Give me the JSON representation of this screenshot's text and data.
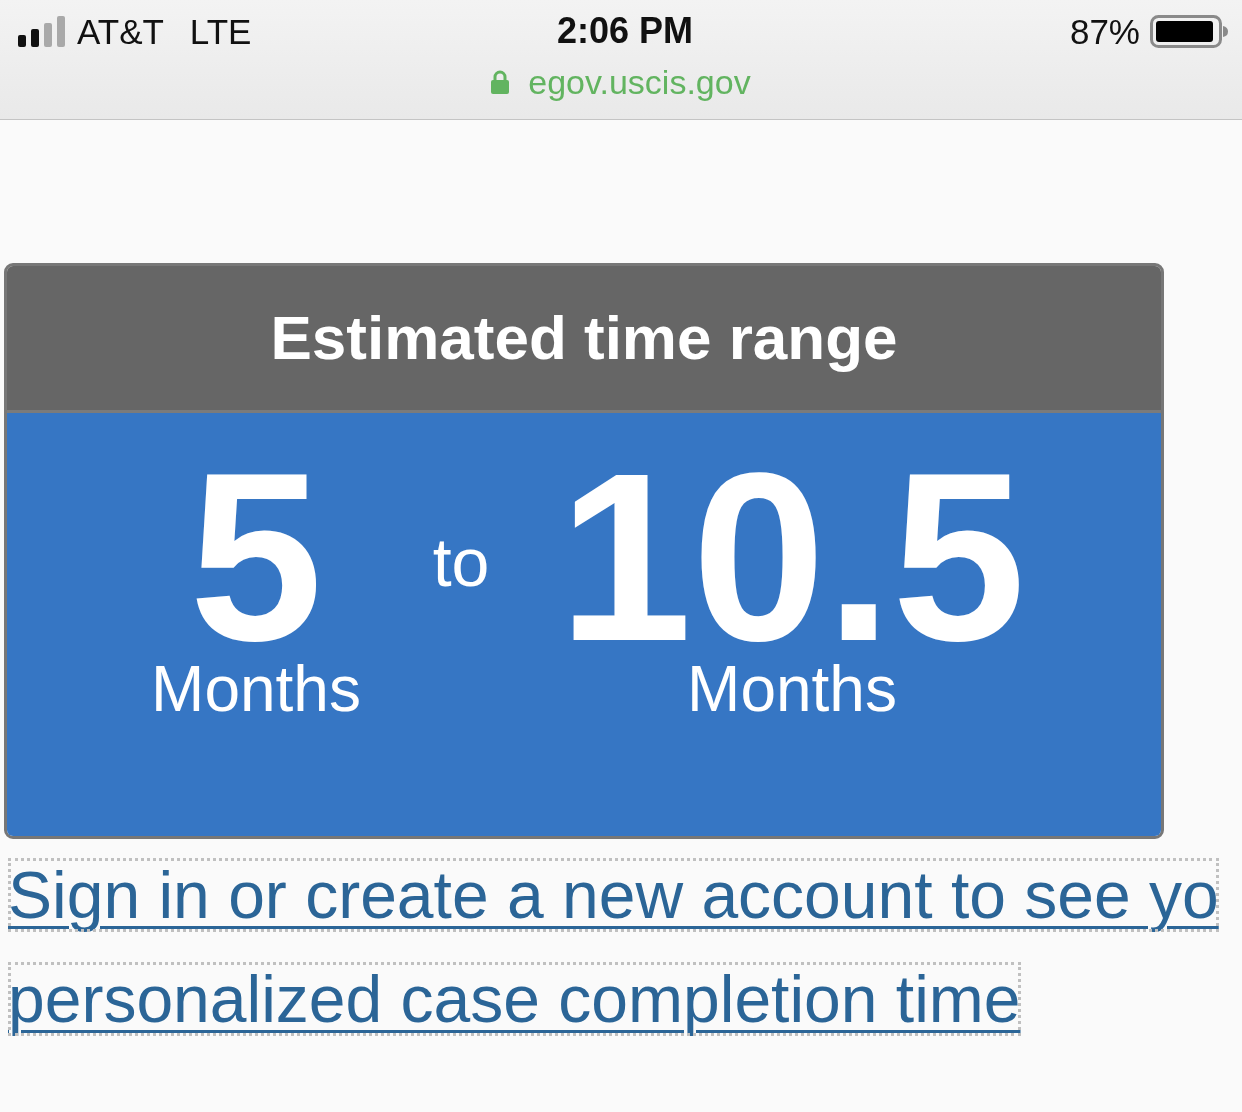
{
  "status_bar": {
    "carrier": "AT&T",
    "network": "LTE",
    "time": "2:06 PM",
    "battery": "87%",
    "url": "egov.uscis.gov"
  },
  "estimate_card": {
    "title": "Estimated time range",
    "range_start": {
      "value": "5",
      "unit": "Months"
    },
    "separator": "to",
    "range_end": {
      "value": "10.5",
      "unit": "Months"
    }
  },
  "link": {
    "lines": [
      "Sign in or create a new account to see yo",
      "personalized case completion time"
    ]
  }
}
